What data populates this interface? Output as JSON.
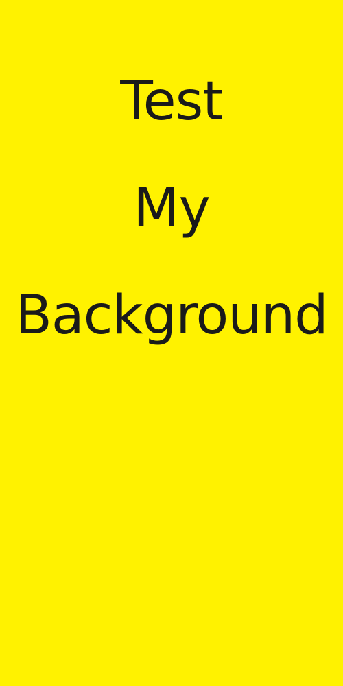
{
  "colors": {
    "background": "#FFF200",
    "text": "#1A1A1A"
  },
  "text_lines": [
    "Test",
    "My",
    "Background"
  ]
}
